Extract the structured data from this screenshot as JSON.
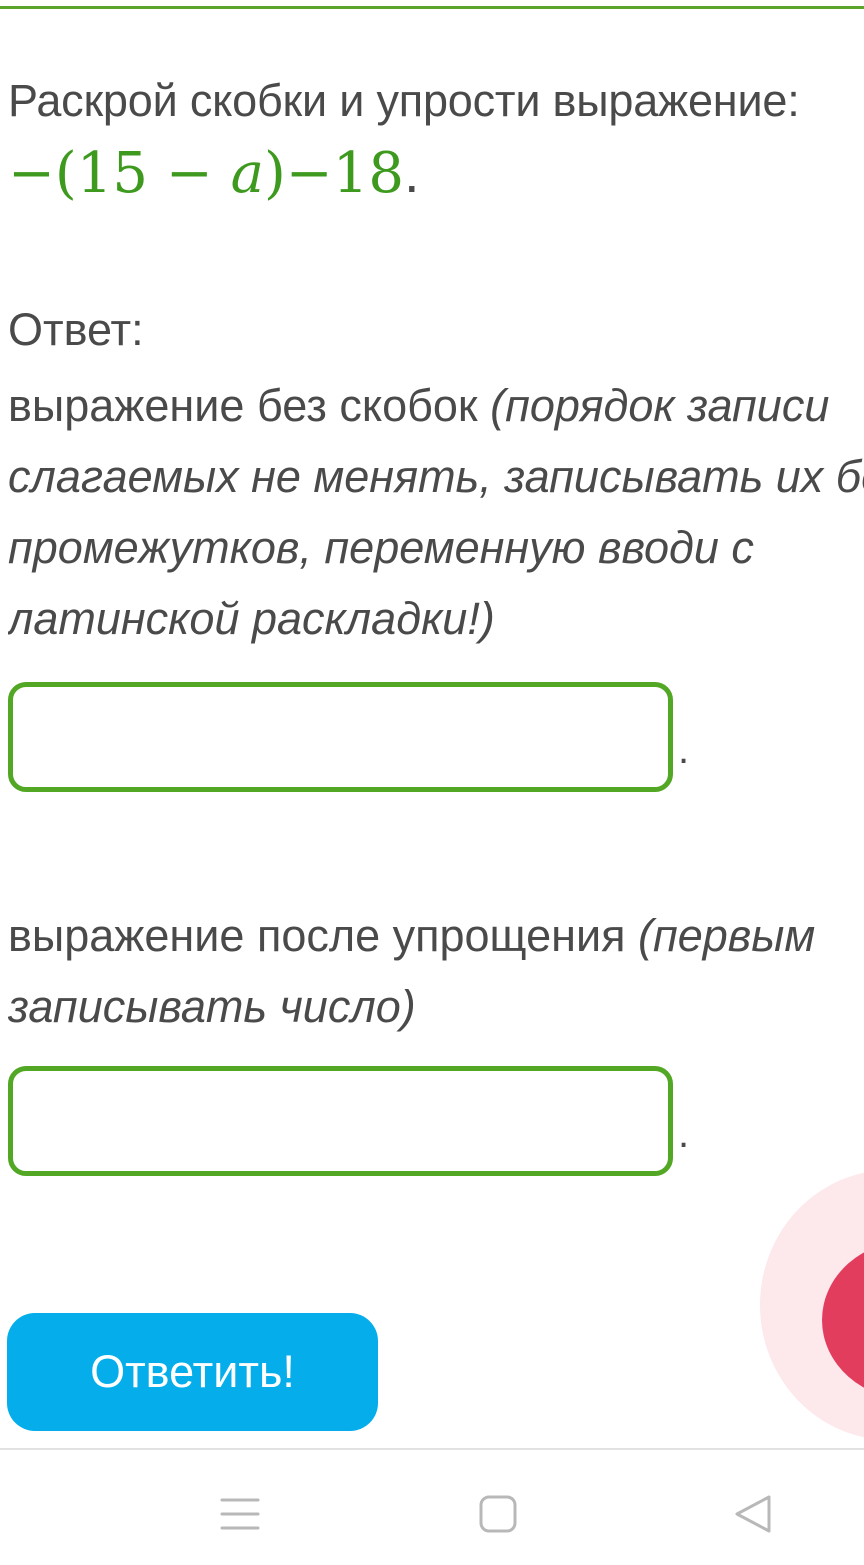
{
  "task": {
    "text": "Раскрой скобки и упрости выражение:",
    "math": {
      "lead": "−(15 − ",
      "variable": "a",
      "tail": ")−18",
      "period": "."
    }
  },
  "answer_label": "Ответ:",
  "block1": {
    "line1_plain": "выражение без скобок ",
    "line1_italic": "(порядок записи",
    "line2": "слагаемых не менять, записывать их без",
    "line3": "промежутков, переменную вводи с",
    "line4": "латинской раскладки!)"
  },
  "field1": {
    "value": "",
    "placeholder": "",
    "trailing": "."
  },
  "block2": {
    "line1_plain": "выражение после упрощения ",
    "line1_italic": "(первым",
    "line2": "записывать число)"
  },
  "field2": {
    "value": "",
    "placeholder": "",
    "trailing": "."
  },
  "submit_label": "Ответить!",
  "colors": {
    "accent_green": "#52a825",
    "math_green": "#3e9a1e",
    "button_blue": "#05aeea",
    "float_button": "#e33d5e"
  },
  "nav": {
    "icons": [
      "menu-icon",
      "home-square-icon",
      "back-triangle-icon"
    ]
  }
}
